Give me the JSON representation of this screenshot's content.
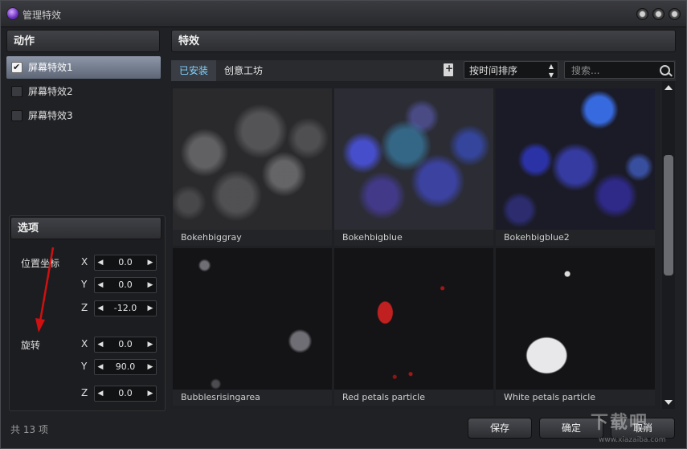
{
  "window": {
    "title": "管理特效"
  },
  "actions": {
    "header": "动作",
    "items": [
      {
        "label": "屏幕特效1",
        "checked": true,
        "selected": true
      },
      {
        "label": "屏幕特效2",
        "checked": false,
        "selected": false
      },
      {
        "label": "屏幕特效3",
        "checked": false,
        "selected": false
      }
    ]
  },
  "options": {
    "header": "选项",
    "position_label": "位置坐标",
    "rotation_label": "旋转",
    "position": {
      "x": "0.0",
      "y": "0.0",
      "z": "-12.0"
    },
    "rotation": {
      "x": "0.0",
      "y": "90.0",
      "z": "0.0"
    },
    "axis_x": "X",
    "axis_y": "Y",
    "axis_z": "Z"
  },
  "count_label": "共 13 项",
  "effects": {
    "header": "特效",
    "tabs": [
      "已安装",
      "创意工坊"
    ],
    "active_tab": 0,
    "sort_select": "按时间排序",
    "search_placeholder": "搜索...",
    "items": [
      {
        "name": "Bokehbiggray",
        "selected": false
      },
      {
        "name": "Bokehbigblue",
        "selected": true
      },
      {
        "name": "Bokehbigblue2",
        "selected": false
      },
      {
        "name": "Bubblesrisingarea",
        "selected": false
      },
      {
        "name": "Red petals particle",
        "selected": false
      },
      {
        "name": "White petals particle",
        "selected": false
      }
    ]
  },
  "buttons": {
    "save": "保存",
    "ok": "确定",
    "cancel": "取消"
  },
  "watermark": {
    "main": "下载吧",
    "sub": "www.xiazaiba.com"
  },
  "colors": {
    "accent_tab": "#7fd3ff",
    "selection": "#9fb2c4",
    "annotation_arrow": "#d01010"
  }
}
